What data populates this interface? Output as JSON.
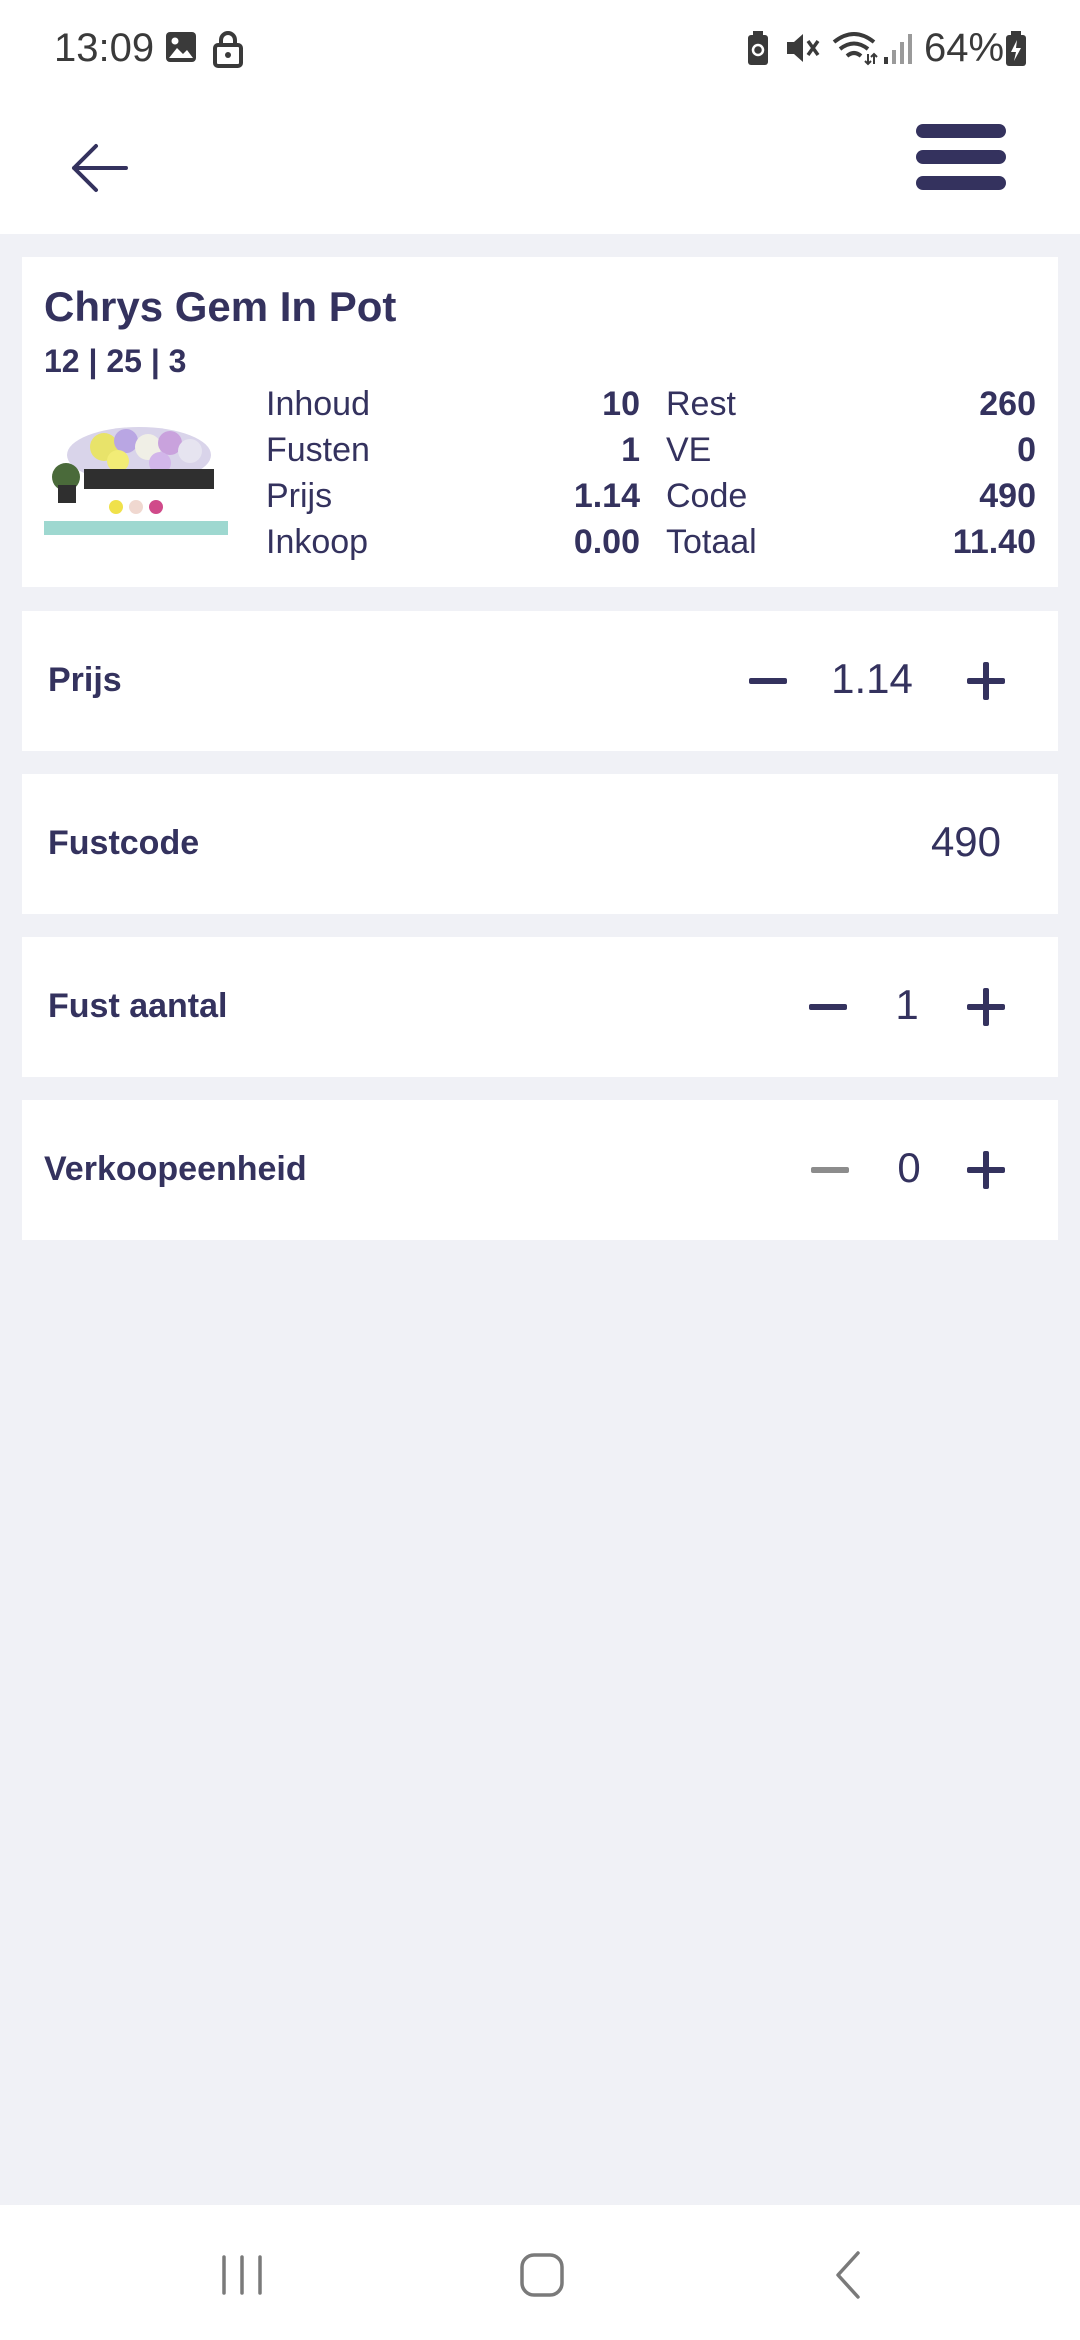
{
  "status_bar": {
    "time": "13:09",
    "battery": "64%"
  },
  "product": {
    "name": "Chrys Gem In Pot",
    "sub": "12 | 25 | 3",
    "left_col": [
      {
        "label": "Inhoud",
        "value": "10"
      },
      {
        "label": "Fusten",
        "value": "1"
      },
      {
        "label": "Prijs",
        "value": "1.14"
      },
      {
        "label": "Inkoop",
        "value": "0.00"
      }
    ],
    "right_col": [
      {
        "label": "Rest",
        "value": "260"
      },
      {
        "label": "VE",
        "value": "0"
      },
      {
        "label": "Code",
        "value": "490"
      },
      {
        "label": "Totaal",
        "value": "11.40"
      }
    ]
  },
  "fields": {
    "prijs": {
      "label": "Prijs",
      "value": "1.14"
    },
    "fustcode": {
      "label": "Fustcode",
      "value": "490"
    },
    "fust_aantal": {
      "label": "Fust aantal",
      "value": "1"
    },
    "verkoopeenheid": {
      "label": "Verkoopeenheid",
      "value": "0"
    }
  },
  "colors": {
    "primary": "#34325e",
    "background": "#f0f1f6",
    "card": "#ffffff",
    "disabled": "#8c8c8c"
  }
}
